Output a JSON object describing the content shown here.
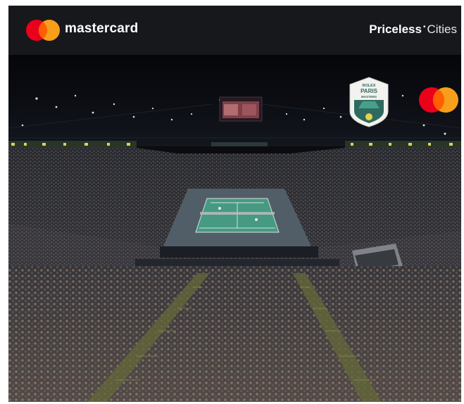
{
  "header": {
    "brand_name": "mastercard",
    "tagline_strong": "Priceless",
    "tagline_light": "Cities"
  },
  "badge": {
    "line1": "ROLEX",
    "line2": "PARIS",
    "line3": "MASTERS"
  },
  "colors": {
    "mc_red": "#eb001b",
    "mc_yellow": "#f79e1b",
    "mc_overlap": "#ff5f00",
    "court_green": "#4ca88e",
    "court_surround": "#5a6770"
  }
}
